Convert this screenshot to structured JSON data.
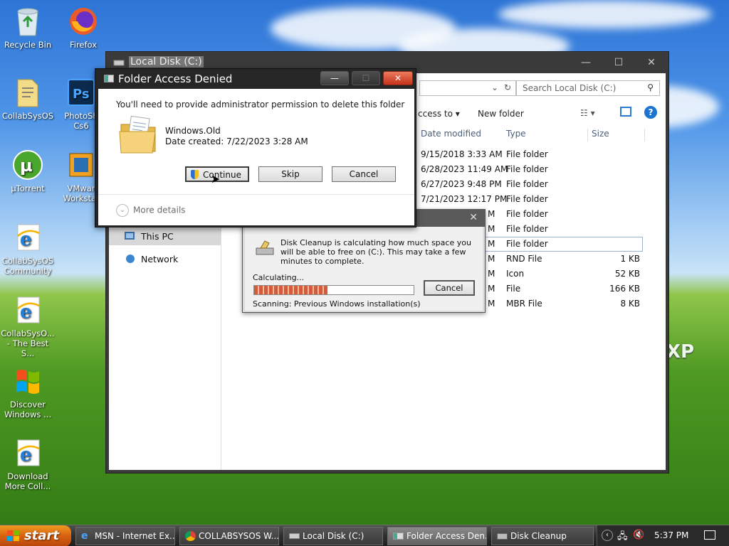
{
  "desktop": {
    "icons": [
      {
        "label": "Recycle Bin",
        "icon": "recycle-bin-icon"
      },
      {
        "label": "Firefox",
        "icon": "firefox-icon"
      },
      {
        "label": "CollabSysOS",
        "icon": "document-icon"
      },
      {
        "label": "PhotoSh",
        "label2": "Cs6",
        "icon": "photoshop-icon"
      },
      {
        "label": "µTorrent",
        "icon": "utorrent-icon"
      },
      {
        "label": "VMwar",
        "label2": "Workstat",
        "icon": "vmware-icon"
      },
      {
        "label": "CollabSysOS",
        "label2": "Community",
        "icon": "internet-explorer-icon"
      },
      {
        "label": "CollabSysO...",
        "label2": "- The Best S...",
        "icon": "internet-explorer-icon"
      },
      {
        "label": "Discover",
        "label2": "Windows ...",
        "icon": "windows-flag-icon"
      },
      {
        "label": "Download",
        "label2": "More Coll...",
        "icon": "internet-explorer-icon"
      }
    ],
    "watermark": "XP"
  },
  "explorer": {
    "title": "Local Disk (C:)",
    "search_placeholder": "Search Local Disk (C:)",
    "toolbar": {
      "share": "ccess to",
      "new_folder": "New folder"
    },
    "columns": {
      "date": "Date modified",
      "type": "Type",
      "size": "Size"
    },
    "sidebar": {
      "this_pc": "This PC",
      "network": "Network"
    },
    "rows": [
      {
        "date": "9/15/2018 3:33 AM",
        "type": "File folder",
        "size": ""
      },
      {
        "date": "6/28/2023 11:49 AM",
        "type": "File folder",
        "size": ""
      },
      {
        "date": "6/27/2023 9:48 PM",
        "type": "File folder",
        "size": ""
      },
      {
        "date": "7/21/2023 12:17 PM",
        "type": "File folder",
        "size": ""
      },
      {
        "date": "M",
        "type": "File folder",
        "size": ""
      },
      {
        "date": "M",
        "type": "File folder",
        "size": ""
      },
      {
        "date": "M",
        "type": "File folder",
        "size": ""
      },
      {
        "date": "M",
        "type": "RND File",
        "size": "1 KB"
      },
      {
        "date": "M",
        "type": "Icon",
        "size": "52 KB"
      },
      {
        "date": "M",
        "type": "File",
        "size": "166 KB"
      },
      {
        "date": "M",
        "type": "MBR File",
        "size": "8 KB"
      }
    ]
  },
  "folder_access_denied": {
    "title": "Folder Access Denied",
    "message": "You'll need to provide administrator permission to delete this folder",
    "folder_name": "Windows.Old",
    "date_created": "Date created: 7/22/2023 3:28 AM",
    "continue_label": "Continue",
    "skip_label": "Skip",
    "cancel_label": "Cancel",
    "more_details": "More details"
  },
  "disk_cleanup": {
    "message": "Disk Cleanup is calculating how much space you will be able to free on  (C:). This may take a few minutes to complete.",
    "calculating": "Calculating...",
    "progress": 0.46,
    "cancel_label": "Cancel",
    "scanning": "Scanning:   Previous Windows installation(s)"
  },
  "taskbar": {
    "start_label": "start",
    "tasks": [
      {
        "label": "MSN - Internet Ex...",
        "active": false
      },
      {
        "label": "COLLABSYSOS W...",
        "active": false
      },
      {
        "label": "Local Disk (C:)",
        "active": false
      },
      {
        "label": "Folder Access Den...",
        "active": true
      },
      {
        "label": "Disk Cleanup",
        "active": false
      }
    ],
    "clock": "5:37 PM"
  }
}
